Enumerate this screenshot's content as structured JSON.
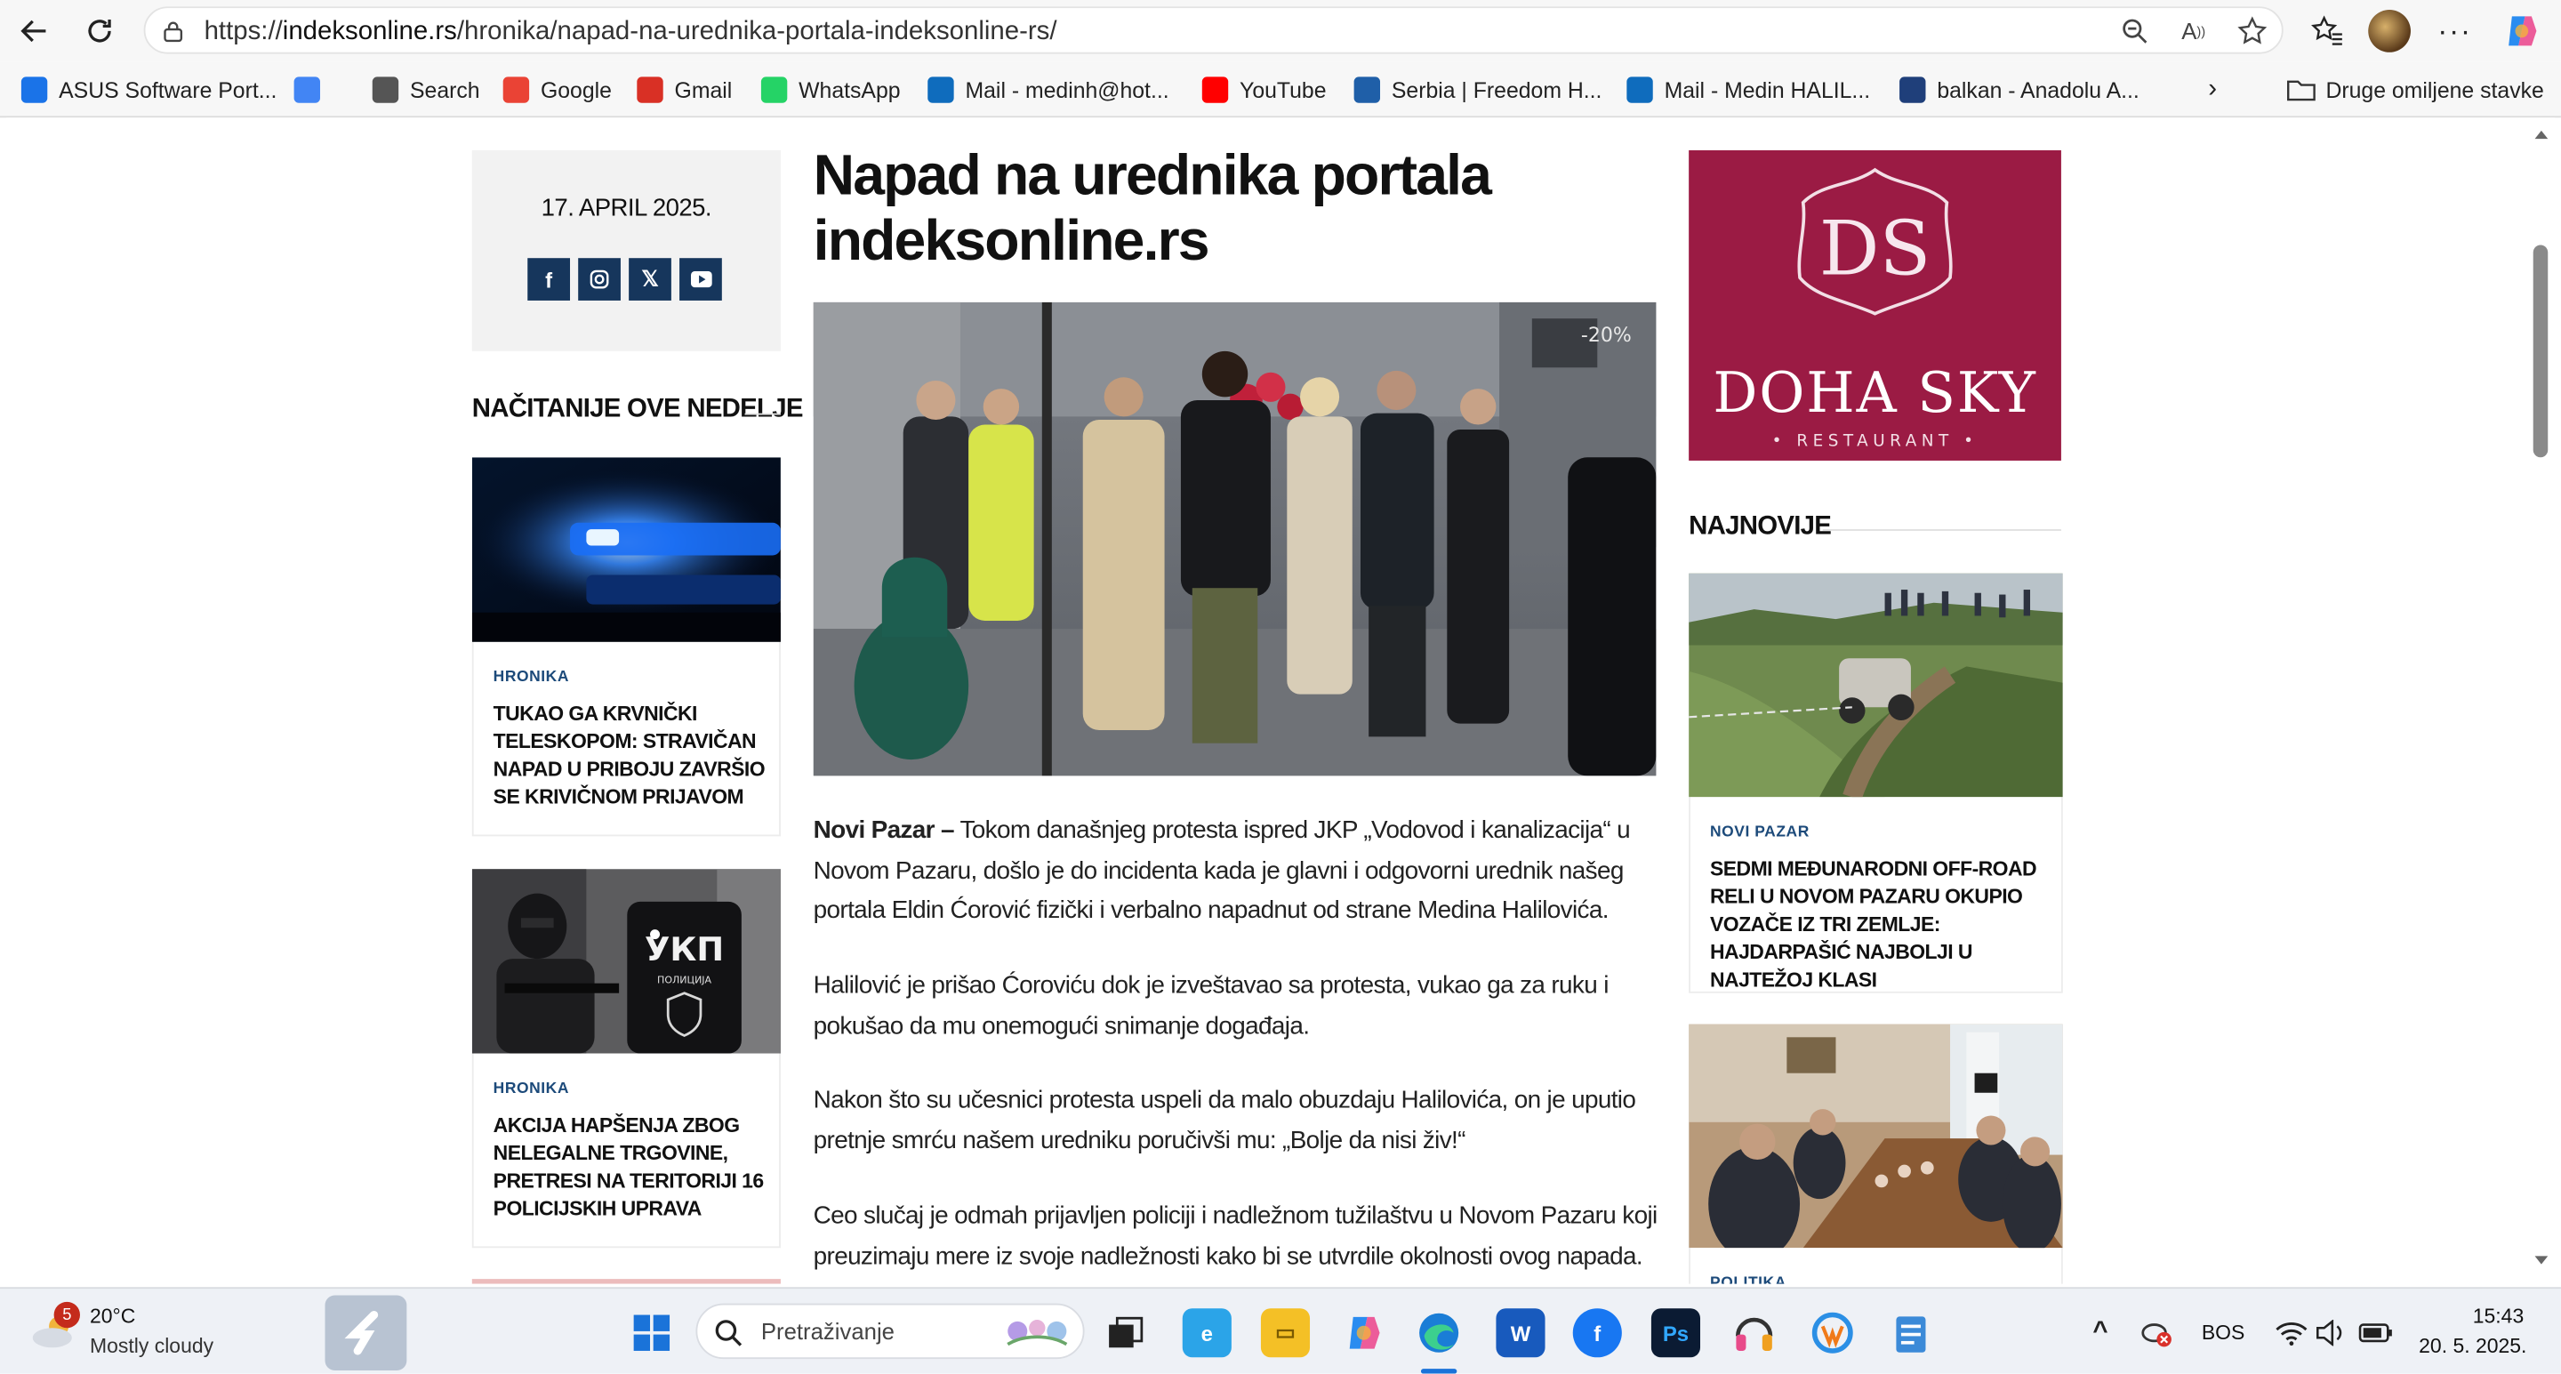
{
  "browser": {
    "url_prefix": "https://",
    "url_host": "indeksonline.rs",
    "url_path": "/hronika/napad-na-urednika-portala-indeksonline-rs/",
    "bookmarks": [
      {
        "label": "ASUS Software Port...",
        "icon": "asus-icon",
        "color": "#1a73e8"
      },
      {
        "label": "",
        "icon": "translate-icon",
        "color": "#4285f4"
      },
      {
        "label": "Search",
        "icon": "search-icon",
        "color": "#555555"
      },
      {
        "label": "Google",
        "icon": "google-icon",
        "color": "#ea4335"
      },
      {
        "label": "Gmail",
        "icon": "gmail-icon",
        "color": "#d93025"
      },
      {
        "label": "WhatsApp",
        "icon": "whatsapp-icon",
        "color": "#25d366"
      },
      {
        "label": "Mail - medinh@hot...",
        "icon": "outlook-icon",
        "color": "#0f6cbd"
      },
      {
        "label": "YouTube",
        "icon": "youtube-icon",
        "color": "#ff0000"
      },
      {
        "label": "Serbia | Freedom H...",
        "icon": "freedom-house-icon",
        "color": "#1f5fa8"
      },
      {
        "label": "Mail - Medin HALIL...",
        "icon": "outlook-icon",
        "color": "#0f6cbd"
      },
      {
        "label": "balkan - Anadolu A...",
        "icon": "anadolu-icon",
        "color": "#1f3f7a"
      }
    ],
    "other_favorites": "Druge omiljene stavke"
  },
  "page": {
    "date": "17. APRIL 2025.",
    "most_read_title": "NAČITANIJE OVE NEDELJE",
    "left_cards": [
      {
        "category": "HRONIKA",
        "title": "TUKAO GA KRVNIČKI TELESKOPOM: STRAVIČAN NAPAD U PRIBOJU ZAVRŠIO SE KRIVIČNOM PRIJAVOM"
      },
      {
        "category": "HRONIKA",
        "title": "AKCIJA HAPŠENJA ZBOG NELEGALNE TRGOVINE, PRETRESI NA TERITORIJI 16 POLICIJSKIH UPRAVA"
      }
    ],
    "card2_badge": "УКП",
    "card2_badge2": "ПОЛИЦИЈА",
    "headline": "Napad na urednika portala indeksonline.rs",
    "hero_sign": "-20%",
    "article": {
      "lead_bold": "Novi Pazar –",
      "p1_rest": " Tokom današnjeg protesta ispred JKP „Vodovod i kanalizacija“ u Novom Pazaru, došlo je do incidenta kada je glavni i odgovorni urednik našeg portala Eldin Ćorović fizički i verbalno napadnut od strane Medina Halilovića.",
      "p2": "Halilović je prišao Ćoroviću dok je izveštavao sa protesta, vukao ga za ruku i pokušao da mu onemogući snimanje događaja.",
      "p3": "Nakon što su učesnici protesta uspeli da malo obuzdaju Halilovića, on je uputio pretnje smrću našem uredniku poručivši mu: „Bolje da nisi živ!“",
      "p4": "Ceo slučaj je odmah prijavljen policiji i nadležnom tužilaštvu u Novom Pazaru koji preuzimaju mere iz svoje nadležnosti kako bi se utvrdile okolnosti ovog napada."
    },
    "ad": {
      "logo": "DS",
      "brand": "DOHA SKY",
      "sub": "• RESTAURANT •",
      "color": "#9b1b44"
    },
    "latest_title": "NAJNOVIJE",
    "right_cards": [
      {
        "category": "NOVI PAZAR",
        "title": "SEDMI MEĐUNARODNI OFF-ROAD RELI U NOVOM PAZARU OKUPIO VOZAČE IZ TRI ZEMLJE: HAJDARPAŠIĆ NAJBOLJI U NAJTEŽOJ KLASI"
      },
      {
        "category": "POLITIKA",
        "title": ""
      }
    ]
  },
  "taskbar": {
    "weather_badge": "5",
    "temperature": "20°C",
    "weather": "Mostly cloudy",
    "search_placeholder": "Pretraživanje",
    "language": "BOS",
    "time": "15:43",
    "date": "20. 5. 2025."
  }
}
